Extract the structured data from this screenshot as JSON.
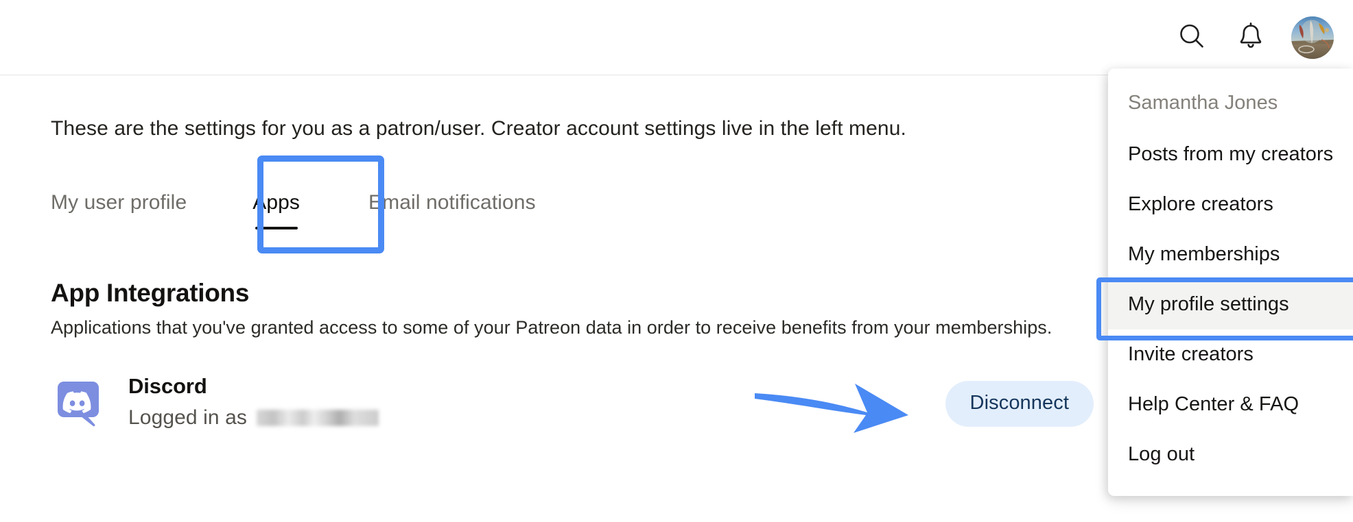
{
  "topbar": {
    "search_icon": "search-icon",
    "notifications_icon": "bell-icon",
    "avatar_label": "user-avatar"
  },
  "main": {
    "intro": "These are the settings for you as a patron/user. Creator account settings live in the left menu.",
    "tabs": [
      {
        "label": "My user profile",
        "active": false
      },
      {
        "label": "Apps",
        "active": true
      },
      {
        "label": "Email notifications",
        "active": false
      }
    ],
    "section": {
      "title": "App Integrations",
      "subtitle": "Applications that you've granted access to some of your Patreon data in order to receive benefits from your memberships."
    },
    "apps": [
      {
        "name": "Discord",
        "status_prefix": "Logged in as",
        "status_value_redacted": true,
        "action_label": "Disconnect"
      }
    ]
  },
  "dropdown": {
    "account_name": "Samantha Jones",
    "items": [
      {
        "label": "Posts from my creators",
        "highlighted": false
      },
      {
        "label": "Explore creators",
        "highlighted": false
      },
      {
        "label": "My memberships",
        "highlighted": false
      },
      {
        "label": "My profile settings",
        "highlighted": true
      },
      {
        "label": "Invite creators",
        "highlighted": false
      },
      {
        "label": "Help Center & FAQ",
        "highlighted": false
      },
      {
        "label": "Log out",
        "highlighted": false
      }
    ]
  },
  "annotations": {
    "highlight_color": "#4a8af4",
    "arrow_color": "#4a8af4",
    "apps_tab_box": "blue-rectangle-around-apps-tab",
    "profile_settings_box": "blue-rectangle-around-my-profile-settings",
    "disconnect_arrow": "blue-arrow-pointing-to-disconnect"
  },
  "colors": {
    "accent_blue": "#4a8af4",
    "button_bg": "#e3eefc",
    "button_text": "#14365c",
    "discord_purple": "#7d8ee0",
    "text_primary": "#131210",
    "text_muted": "#6f6d68"
  }
}
